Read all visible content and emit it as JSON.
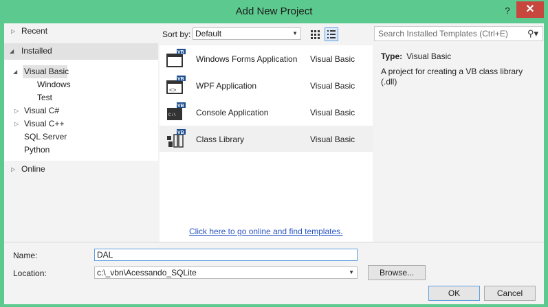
{
  "window": {
    "title": "Add New Project",
    "help": "?",
    "close": "✕"
  },
  "tree": {
    "recent": "Recent",
    "installed": "Installed",
    "visual_basic": "Visual Basic",
    "windows": "Windows",
    "test": "Test",
    "visual_csharp": "Visual C#",
    "visual_cpp": "Visual C++",
    "sql_server": "SQL Server",
    "python": "Python",
    "online": "Online"
  },
  "sort": {
    "label": "Sort by:",
    "value": "Default"
  },
  "search": {
    "placeholder": "Search Installed Templates (Ctrl+E)"
  },
  "templates": [
    {
      "name": "Windows Forms Application",
      "language": "Visual Basic"
    },
    {
      "name": "WPF Application",
      "language": "Visual Basic"
    },
    {
      "name": "Console Application",
      "language": "Visual Basic"
    },
    {
      "name": "Class Library",
      "language": "Visual Basic"
    }
  ],
  "online_link": "Click here to go online and find templates.",
  "details": {
    "type_label": "Type:",
    "type_value": "Visual Basic",
    "description": "A project for creating a VB class library (.dll)"
  },
  "form": {
    "name_label": "Name:",
    "name_value": "DAL",
    "location_label": "Location:",
    "location_value": "c:\\_vbn\\Acessando_SQLite",
    "browse": "Browse...",
    "ok": "OK",
    "cancel": "Cancel"
  },
  "colors": {
    "titlebar": "#5cc98e",
    "close": "#c7463d",
    "link": "#2b55c2",
    "focus": "#5f9ddf"
  }
}
